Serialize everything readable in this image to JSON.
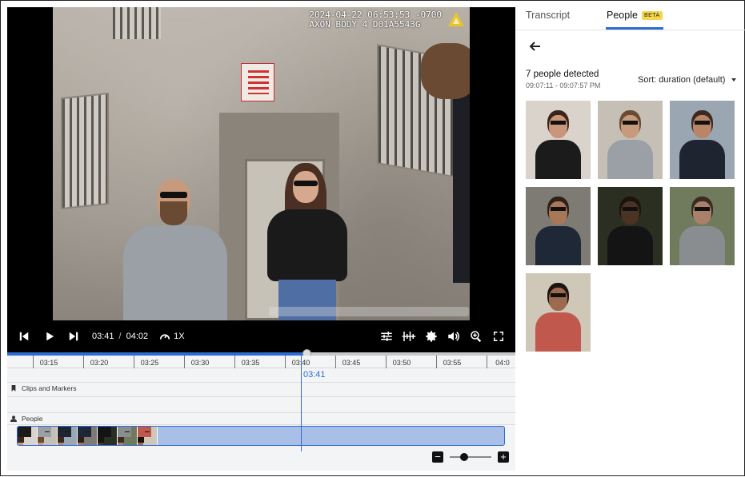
{
  "video": {
    "overlay_line1": "2024-04-22 06:53:53 -0700",
    "overlay_line2": "AXON BODY 4 D01A5543G"
  },
  "controls": {
    "current_time": "03:41",
    "separator": "/",
    "duration": "04:02",
    "speed": "1X",
    "progress": 0.5906
  },
  "timeline": {
    "ticks": [
      "03:15",
      "03:20",
      "03:25",
      "03:30",
      "03:35",
      "03:40",
      "03:45",
      "03:50",
      "03:55",
      "04:0"
    ],
    "playhead_time": "03:41",
    "tracks": [
      {
        "label": "Clips and Markers"
      },
      {
        "label": "People"
      }
    ],
    "zoom_level": 0.35
  },
  "panel": {
    "tabs": [
      {
        "label": "Transcript",
        "active": false
      },
      {
        "label": "People",
        "active": true,
        "badge": "BETA"
      }
    ],
    "detected_label": "7 people detected",
    "time_range": "09:07:11 - 09:07:57 PM",
    "sort_label": "Sort: duration (default)"
  },
  "people": [
    {
      "bg": "#d9d3cc",
      "head": "#c9967b",
      "hair": "#3b2418",
      "torso": "#1b1b1b"
    },
    {
      "bg": "#c5bfb6",
      "head": "#c89a7d",
      "hair": "#6b4a34",
      "torso": "#9aa0a6"
    },
    {
      "bg": "#9aa7b3",
      "head": "#b98468",
      "hair": "#3c2a20",
      "torso": "#1f2530"
    },
    {
      "bg": "#7e7a74",
      "head": "#a87758",
      "hair": "#2e2018",
      "torso": "#1f2836"
    },
    {
      "bg": "#2b2f22",
      "head": "#4a3322",
      "hair": "#1b140e",
      "torso": "#141414"
    },
    {
      "bg": "#6f7b5c",
      "head": "#a98069",
      "hair": "#3a2c22",
      "torso": "#8a8d8f"
    },
    {
      "bg": "#cfc7b8",
      "head": "#9c6a4e",
      "hair": "#1c1410",
      "torso": "#c0584e"
    }
  ],
  "colors": {
    "accent": "#2e6bd0",
    "beta": "#f6d64a"
  }
}
